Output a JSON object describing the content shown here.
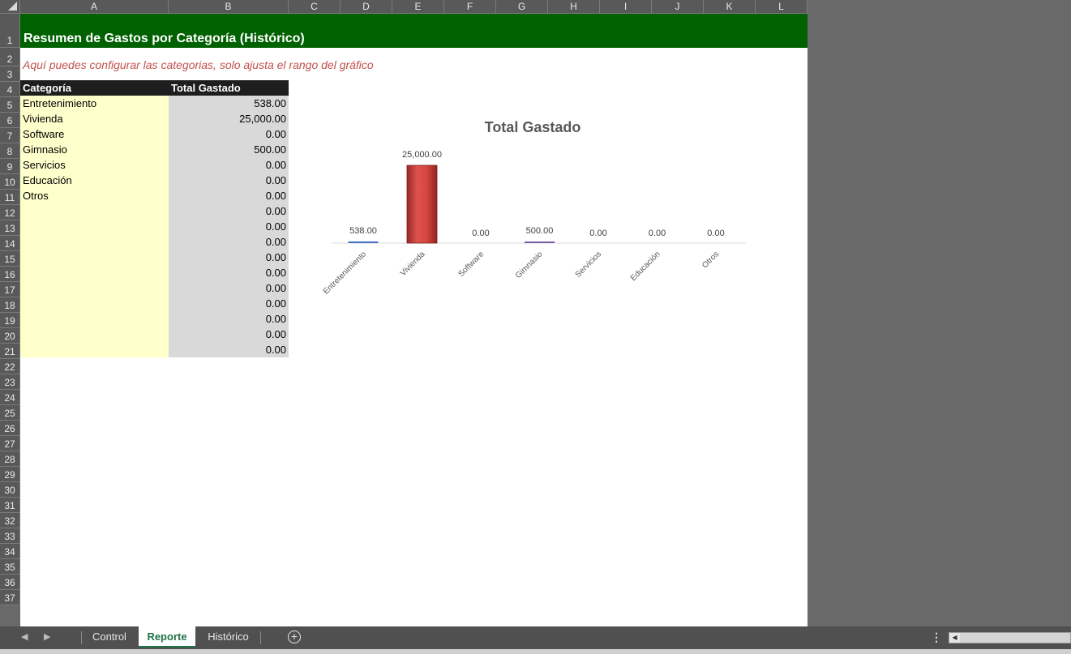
{
  "columns": [
    "A",
    "B",
    "C",
    "D",
    "E",
    "F",
    "G",
    "H",
    "I",
    "J",
    "K",
    "L"
  ],
  "rows": [
    "1",
    "2",
    "3",
    "4",
    "5",
    "6",
    "7",
    "8",
    "9",
    "10",
    "11",
    "12",
    "13",
    "14",
    "15",
    "16",
    "17",
    "18",
    "19",
    "20",
    "21",
    "22",
    "23",
    "24",
    "25",
    "26",
    "27",
    "28",
    "29",
    "30",
    "31",
    "32",
    "33",
    "34",
    "35",
    "36",
    "37"
  ],
  "sheet": {
    "title": "Resumen de Gastos por Categoría (Histórico)",
    "subtitle": "Aquí puedes configurar las categorias, solo ajusta el rango del gráfico",
    "table_headers": {
      "category": "Categoría",
      "total": "Total Gastado"
    },
    "table_rows": [
      {
        "category": "Entretenimiento",
        "total": "538.00"
      },
      {
        "category": "Vivienda",
        "total": "25,000.00"
      },
      {
        "category": "Software",
        "total": "0.00"
      },
      {
        "category": "Gimnasio",
        "total": "500.00"
      },
      {
        "category": "Servicios",
        "total": "0.00"
      },
      {
        "category": "Educación",
        "total": "0.00"
      },
      {
        "category": "Otros",
        "total": "0.00"
      },
      {
        "category": "",
        "total": "0.00"
      },
      {
        "category": "",
        "total": "0.00"
      },
      {
        "category": "",
        "total": "0.00"
      },
      {
        "category": "",
        "total": "0.00"
      },
      {
        "category": "",
        "total": "0.00"
      },
      {
        "category": "",
        "total": "0.00"
      },
      {
        "category": "",
        "total": "0.00"
      },
      {
        "category": "",
        "total": "0.00"
      },
      {
        "category": "",
        "total": "0.00"
      },
      {
        "category": "",
        "total": "0.00"
      }
    ]
  },
  "chart_data": {
    "type": "bar",
    "title": "Total Gastado",
    "categories": [
      "Entretenimiento",
      "Vivienda",
      "Software",
      "Gimnasio",
      "Servicios",
      "Educación",
      "Otros"
    ],
    "values": [
      538,
      25000,
      0,
      500,
      0,
      0,
      0
    ],
    "data_labels": [
      "538.00",
      "25,000.00",
      "0.00",
      "500.00",
      "0.00",
      "0.00",
      "0.00"
    ],
    "ylim": [
      0,
      25000
    ],
    "grid": false,
    "legend": "none",
    "bar_colors": [
      "#4472c4",
      "#c0504d",
      "#4472c4",
      "#7b5ea7",
      "#4472c4",
      "#4472c4",
      "#4472c4"
    ]
  },
  "tabs": [
    {
      "label": "Control",
      "active": false
    },
    {
      "label": "Reporte",
      "active": true
    },
    {
      "label": "Histórico",
      "active": false
    }
  ],
  "icons": {
    "prev_sheet": "chevron-left-icon",
    "next_sheet": "chevron-right-icon",
    "add_sheet": "plus-circle-icon",
    "more": "more-options-icon",
    "scroll_left": "scroll-left-icon"
  },
  "colors": {
    "title_band": "#006100",
    "subtitle": "#c0504d",
    "header": "#1e1e1e",
    "category_fill": "#ffffcc",
    "value_fill": "#d9d9d9",
    "active_tab": "#217346"
  }
}
